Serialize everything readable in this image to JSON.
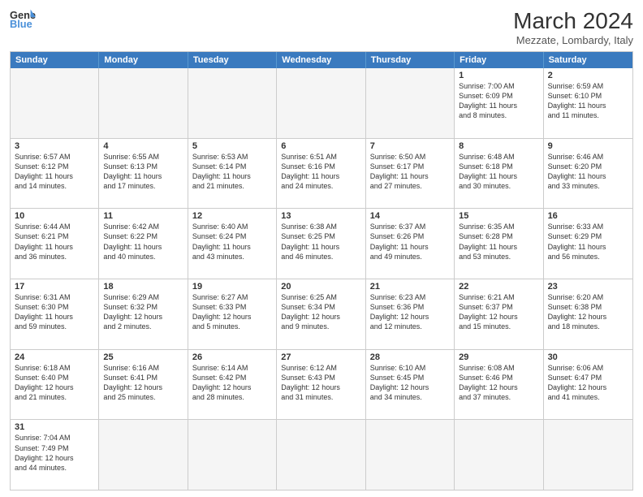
{
  "header": {
    "logo_general": "General",
    "logo_blue": "Blue",
    "title": "March 2024",
    "subtitle": "Mezzate, Lombardy, Italy"
  },
  "weekdays": [
    "Sunday",
    "Monday",
    "Tuesday",
    "Wednesday",
    "Thursday",
    "Friday",
    "Saturday"
  ],
  "rows": [
    [
      {
        "day": "",
        "info": ""
      },
      {
        "day": "",
        "info": ""
      },
      {
        "day": "",
        "info": ""
      },
      {
        "day": "",
        "info": ""
      },
      {
        "day": "",
        "info": ""
      },
      {
        "day": "1",
        "info": "Sunrise: 7:00 AM\nSunset: 6:09 PM\nDaylight: 11 hours\nand 8 minutes."
      },
      {
        "day": "2",
        "info": "Sunrise: 6:59 AM\nSunset: 6:10 PM\nDaylight: 11 hours\nand 11 minutes."
      }
    ],
    [
      {
        "day": "3",
        "info": "Sunrise: 6:57 AM\nSunset: 6:12 PM\nDaylight: 11 hours\nand 14 minutes."
      },
      {
        "day": "4",
        "info": "Sunrise: 6:55 AM\nSunset: 6:13 PM\nDaylight: 11 hours\nand 17 minutes."
      },
      {
        "day": "5",
        "info": "Sunrise: 6:53 AM\nSunset: 6:14 PM\nDaylight: 11 hours\nand 21 minutes."
      },
      {
        "day": "6",
        "info": "Sunrise: 6:51 AM\nSunset: 6:16 PM\nDaylight: 11 hours\nand 24 minutes."
      },
      {
        "day": "7",
        "info": "Sunrise: 6:50 AM\nSunset: 6:17 PM\nDaylight: 11 hours\nand 27 minutes."
      },
      {
        "day": "8",
        "info": "Sunrise: 6:48 AM\nSunset: 6:18 PM\nDaylight: 11 hours\nand 30 minutes."
      },
      {
        "day": "9",
        "info": "Sunrise: 6:46 AM\nSunset: 6:20 PM\nDaylight: 11 hours\nand 33 minutes."
      }
    ],
    [
      {
        "day": "10",
        "info": "Sunrise: 6:44 AM\nSunset: 6:21 PM\nDaylight: 11 hours\nand 36 minutes."
      },
      {
        "day": "11",
        "info": "Sunrise: 6:42 AM\nSunset: 6:22 PM\nDaylight: 11 hours\nand 40 minutes."
      },
      {
        "day": "12",
        "info": "Sunrise: 6:40 AM\nSunset: 6:24 PM\nDaylight: 11 hours\nand 43 minutes."
      },
      {
        "day": "13",
        "info": "Sunrise: 6:38 AM\nSunset: 6:25 PM\nDaylight: 11 hours\nand 46 minutes."
      },
      {
        "day": "14",
        "info": "Sunrise: 6:37 AM\nSunset: 6:26 PM\nDaylight: 11 hours\nand 49 minutes."
      },
      {
        "day": "15",
        "info": "Sunrise: 6:35 AM\nSunset: 6:28 PM\nDaylight: 11 hours\nand 53 minutes."
      },
      {
        "day": "16",
        "info": "Sunrise: 6:33 AM\nSunset: 6:29 PM\nDaylight: 11 hours\nand 56 minutes."
      }
    ],
    [
      {
        "day": "17",
        "info": "Sunrise: 6:31 AM\nSunset: 6:30 PM\nDaylight: 11 hours\nand 59 minutes."
      },
      {
        "day": "18",
        "info": "Sunrise: 6:29 AM\nSunset: 6:32 PM\nDaylight: 12 hours\nand 2 minutes."
      },
      {
        "day": "19",
        "info": "Sunrise: 6:27 AM\nSunset: 6:33 PM\nDaylight: 12 hours\nand 5 minutes."
      },
      {
        "day": "20",
        "info": "Sunrise: 6:25 AM\nSunset: 6:34 PM\nDaylight: 12 hours\nand 9 minutes."
      },
      {
        "day": "21",
        "info": "Sunrise: 6:23 AM\nSunset: 6:36 PM\nDaylight: 12 hours\nand 12 minutes."
      },
      {
        "day": "22",
        "info": "Sunrise: 6:21 AM\nSunset: 6:37 PM\nDaylight: 12 hours\nand 15 minutes."
      },
      {
        "day": "23",
        "info": "Sunrise: 6:20 AM\nSunset: 6:38 PM\nDaylight: 12 hours\nand 18 minutes."
      }
    ],
    [
      {
        "day": "24",
        "info": "Sunrise: 6:18 AM\nSunset: 6:40 PM\nDaylight: 12 hours\nand 21 minutes."
      },
      {
        "day": "25",
        "info": "Sunrise: 6:16 AM\nSunset: 6:41 PM\nDaylight: 12 hours\nand 25 minutes."
      },
      {
        "day": "26",
        "info": "Sunrise: 6:14 AM\nSunset: 6:42 PM\nDaylight: 12 hours\nand 28 minutes."
      },
      {
        "day": "27",
        "info": "Sunrise: 6:12 AM\nSunset: 6:43 PM\nDaylight: 12 hours\nand 31 minutes."
      },
      {
        "day": "28",
        "info": "Sunrise: 6:10 AM\nSunset: 6:45 PM\nDaylight: 12 hours\nand 34 minutes."
      },
      {
        "day": "29",
        "info": "Sunrise: 6:08 AM\nSunset: 6:46 PM\nDaylight: 12 hours\nand 37 minutes."
      },
      {
        "day": "30",
        "info": "Sunrise: 6:06 AM\nSunset: 6:47 PM\nDaylight: 12 hours\nand 41 minutes."
      }
    ],
    [
      {
        "day": "31",
        "info": "Sunrise: 7:04 AM\nSunset: 7:49 PM\nDaylight: 12 hours\nand 44 minutes."
      },
      {
        "day": "",
        "info": ""
      },
      {
        "day": "",
        "info": ""
      },
      {
        "day": "",
        "info": ""
      },
      {
        "day": "",
        "info": ""
      },
      {
        "day": "",
        "info": ""
      },
      {
        "day": "",
        "info": ""
      }
    ]
  ]
}
